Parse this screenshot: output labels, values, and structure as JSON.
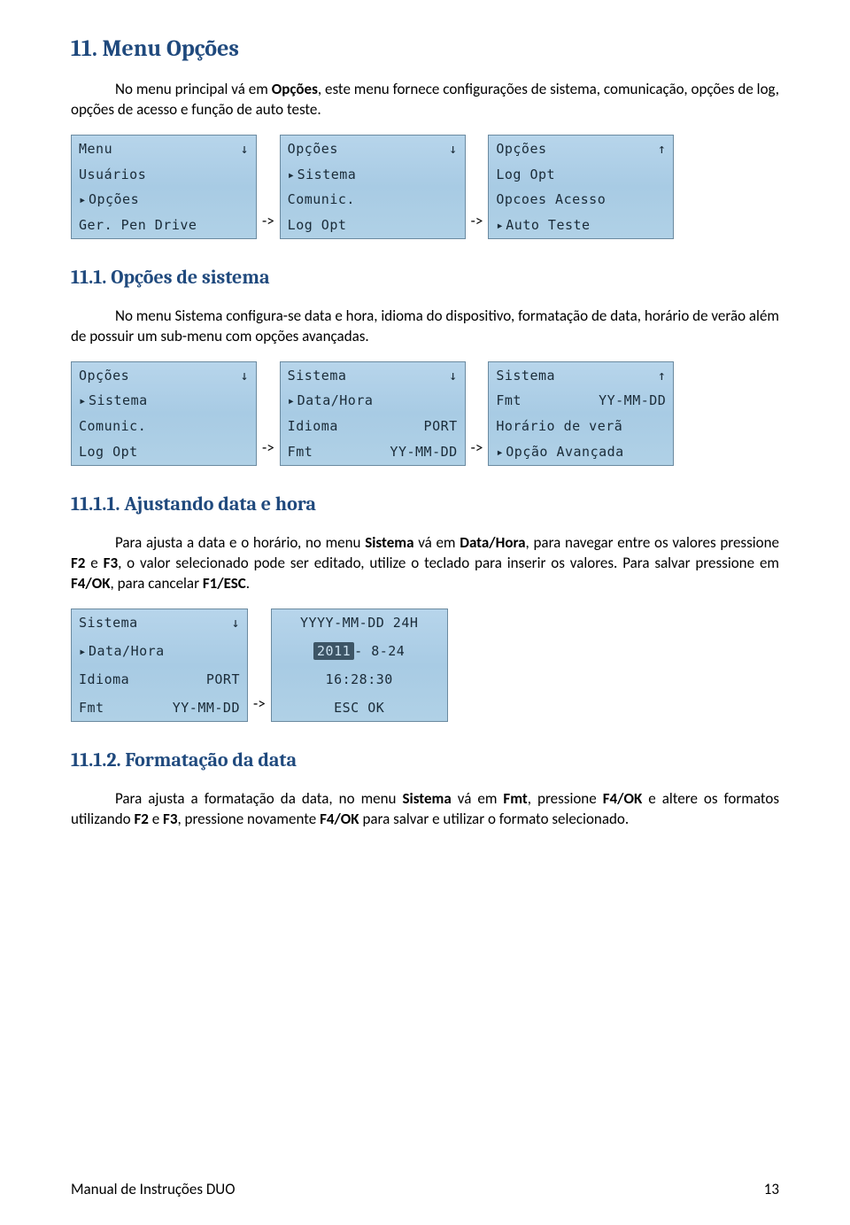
{
  "h_11": "11. Menu Opções",
  "p_11": "No menu principal vá em Opções, este menu fornece configurações de sistema, comunicação, opções de log, opções de acesso e função de auto teste.",
  "arrow": "->",
  "screens_11": {
    "a": {
      "r1l": "Menu",
      "r1r_down": true,
      "r2": "Usuários",
      "r3_sel": "Opções",
      "r4": "Ger. Pen Drive"
    },
    "b": {
      "r1l": "Opções",
      "r1r_down": true,
      "r2_sel": "Sistema",
      "r3": "Comunic.",
      "r4": "Log Opt"
    },
    "c": {
      "r1l": "Opções",
      "r1r_up": true,
      "r2": "Log Opt",
      "r3": "Opcoes Acesso",
      "r4_sel": "Auto Teste"
    }
  },
  "h_111": "11.1. Opções de sistema",
  "p_111": "No menu Sistema configura-se data e hora, idioma do dispositivo, formatação de data, horário de verão além de possuir um sub-menu com opções avançadas.",
  "screens_111": {
    "a": {
      "r1l": "Opções",
      "r1r_down": true,
      "r2_sel": "Sistema",
      "r3": "Comunic.",
      "r4": "Log Opt"
    },
    "b": {
      "r1l": "Sistema",
      "r1r_down": true,
      "r2_sel": "Data/Hora",
      "r3l": "Idioma",
      "r3r": "PORT",
      "r4l": "Fmt",
      "r4r": "YY-MM-DD"
    },
    "c": {
      "r1l": "Sistema",
      "r1r_up": true,
      "r2l": "Fmt",
      "r2r": "YY-MM-DD",
      "r3": "Horário de verã",
      "r4_sel": "Opção Avançada"
    }
  },
  "h_1111": "11.1.1. Ajustando data e hora",
  "p_1111": "Para ajusta a data e o horário, no menu Sistema vá em Data/Hora, para navegar entre os valores pressione F2 e F3, o valor selecionado pode ser editado, utilize o teclado para inserir os valores. Para salvar pressione em F4/OK, para cancelar F1/ESC.",
  "screens_1111": {
    "a": {
      "r1l": "Sistema",
      "r1r_down": true,
      "r2_sel": "Data/Hora",
      "r3l": "Idioma",
      "r3r": "PORT",
      "r4l": "Fmt",
      "r4r": "YY-MM-DD"
    },
    "b": {
      "r1": "YYYY-MM-DD 24H",
      "r2_year": "2011",
      "r2_rest": "- 8-24",
      "r3": "16:28:30",
      "r4": "ESC OK"
    }
  },
  "h_1112": "11.1.2. Formatação da data",
  "p_1112": "Para ajusta a formatação da data, no menu Sistema vá em Fmt, pressione F4/OK e altere os formatos utilizando F2 e F3, pressione novamente F4/OK para salvar e utilizar o formato selecionado.",
  "footer_left": "Manual de Instruções DUO",
  "footer_right": "13"
}
